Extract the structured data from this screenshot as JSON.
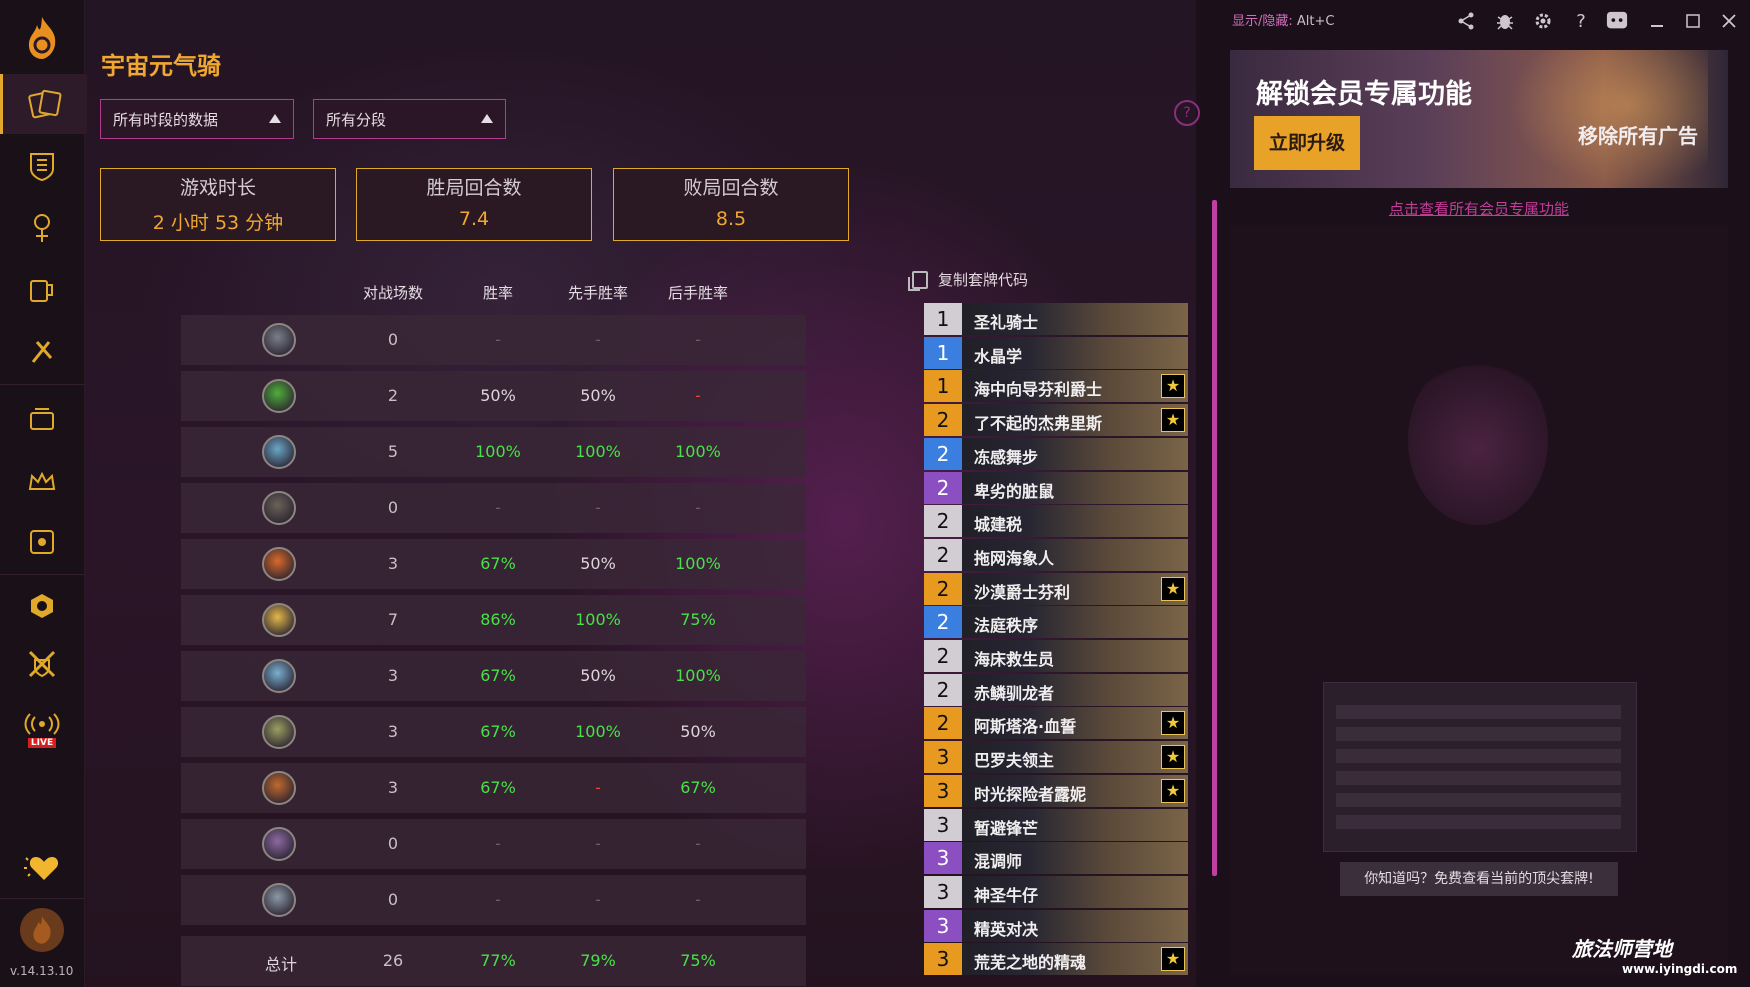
{
  "deck_title": "宇宙元气骑",
  "filters": {
    "time_range": "所有时段的数据",
    "rank_range": "所有分段"
  },
  "help_icon": "?",
  "stats": [
    {
      "label": "游戏时长",
      "value": "2 小时 53 分钟"
    },
    {
      "label": "胜局回合数",
      "value": "7.4"
    },
    {
      "label": "败局回合数",
      "value": "8.5"
    }
  ],
  "table": {
    "headers": [
      "对战场数",
      "胜率",
      "先手胜率",
      "后手胜率"
    ],
    "rows": [
      {
        "class_icon": "death-knight-icon",
        "games": "0",
        "winrate": "-",
        "first": "-",
        "second": "-",
        "colors": [
          "dim",
          "dim",
          "dim"
        ]
      },
      {
        "class_icon": "demon-hunter-icon",
        "games": "2",
        "winrate": "50%",
        "first": "50%",
        "second": "-",
        "colors": [
          "white",
          "white",
          "red"
        ]
      },
      {
        "class_icon": "druid-icon",
        "games": "5",
        "winrate": "100%",
        "first": "100%",
        "second": "100%",
        "colors": [
          "green",
          "green",
          "green"
        ]
      },
      {
        "class_icon": "hunter-icon",
        "games": "0",
        "winrate": "-",
        "first": "-",
        "second": "-",
        "colors": [
          "dim",
          "dim",
          "dim"
        ]
      },
      {
        "class_icon": "mage-icon",
        "games": "3",
        "winrate": "67%",
        "first": "50%",
        "second": "100%",
        "colors": [
          "green",
          "white",
          "green"
        ]
      },
      {
        "class_icon": "paladin-icon",
        "games": "7",
        "winrate": "86%",
        "first": "100%",
        "second": "75%",
        "colors": [
          "green",
          "green",
          "green"
        ]
      },
      {
        "class_icon": "priest-icon",
        "games": "3",
        "winrate": "67%",
        "first": "50%",
        "second": "100%",
        "colors": [
          "green",
          "white",
          "green"
        ]
      },
      {
        "class_icon": "rogue-icon",
        "games": "3",
        "winrate": "67%",
        "first": "100%",
        "second": "50%",
        "colors": [
          "green",
          "green",
          "white"
        ]
      },
      {
        "class_icon": "shaman-icon",
        "games": "3",
        "winrate": "67%",
        "first": "-",
        "second": "67%",
        "colors": [
          "green",
          "red",
          "green"
        ]
      },
      {
        "class_icon": "warlock-icon",
        "games": "0",
        "winrate": "-",
        "first": "-",
        "second": "-",
        "colors": [
          "dim",
          "dim",
          "dim"
        ]
      },
      {
        "class_icon": "warrior-icon",
        "games": "0",
        "winrate": "-",
        "first": "-",
        "second": "-",
        "colors": [
          "dim",
          "dim",
          "dim"
        ]
      }
    ],
    "total": {
      "label": "总计",
      "games": "26",
      "winrate": "77%",
      "first": "79%",
      "second": "75%"
    }
  },
  "deck": {
    "copy_label": "复制套牌代码",
    "cards": [
      {
        "cost": "1",
        "name": "圣礼骑士",
        "rarity": "common",
        "star": false
      },
      {
        "cost": "1",
        "name": "水晶学",
        "rarity": "rare",
        "star": false
      },
      {
        "cost": "1",
        "name": "海中向导芬利爵士",
        "rarity": "legend",
        "star": true
      },
      {
        "cost": "2",
        "name": "了不起的杰弗里斯",
        "rarity": "legend",
        "star": true
      },
      {
        "cost": "2",
        "name": "冻感舞步",
        "rarity": "rare",
        "star": false
      },
      {
        "cost": "2",
        "name": "卑劣的脏鼠",
        "rarity": "epic",
        "star": false
      },
      {
        "cost": "2",
        "name": "城建税",
        "rarity": "common",
        "star": false
      },
      {
        "cost": "2",
        "name": "拖网海象人",
        "rarity": "common",
        "star": false
      },
      {
        "cost": "2",
        "name": "沙漠爵士芬利",
        "rarity": "legend",
        "star": true
      },
      {
        "cost": "2",
        "name": "法庭秩序",
        "rarity": "rare",
        "star": false
      },
      {
        "cost": "2",
        "name": "海床救生员",
        "rarity": "common",
        "star": false
      },
      {
        "cost": "2",
        "name": "赤鳞驯龙者",
        "rarity": "common",
        "star": false
      },
      {
        "cost": "2",
        "name": "阿斯塔洛·血誓",
        "rarity": "legend",
        "star": true
      },
      {
        "cost": "3",
        "name": "巴罗夫领主",
        "rarity": "legend",
        "star": true
      },
      {
        "cost": "3",
        "name": "时光探险者露妮",
        "rarity": "legend",
        "star": true
      },
      {
        "cost": "3",
        "name": "暂避锋芒",
        "rarity": "common",
        "star": false
      },
      {
        "cost": "3",
        "name": "混调师",
        "rarity": "epic",
        "star": false
      },
      {
        "cost": "3",
        "name": "神圣牛仔",
        "rarity": "common",
        "star": false
      },
      {
        "cost": "3",
        "name": "精英对决",
        "rarity": "epic",
        "star": false
      },
      {
        "cost": "3",
        "name": "荒芜之地的精魂",
        "rarity": "legend",
        "star": true
      }
    ]
  },
  "topbar": {
    "hotkey_label": "显示/隐藏:",
    "hotkey": "Alt+C",
    "icons": [
      "share-icon",
      "bug-icon",
      "settings-icon",
      "help-icon",
      "discord-icon",
      "minimize-icon",
      "maximize-icon",
      "close-icon"
    ]
  },
  "banner": {
    "title": "解锁会员专属功能",
    "button": "立即升级",
    "remove_ads": "移除所有广告",
    "link": "点击查看所有会员专属功能"
  },
  "ad": {
    "tip": "你知道吗？免费查看当前的顶尖套牌!"
  },
  "watermark": {
    "brand": "旅法师营地",
    "url": "www.iyingdi.com"
  },
  "version": "v.14.13.10",
  "sidebar_icons": [
    "flame-logo-icon",
    "decks-icon",
    "battlegrounds-icon",
    "mercenaries-icon",
    "tavern-icon",
    "arena-icon",
    "packs-icon",
    "crown-icon",
    "treasure-icon",
    "collection-icon",
    "duels-icon",
    "live-icon",
    "favorite-icon",
    "profile-icon"
  ],
  "live_badge": "LIVE",
  "colors": {
    "accent": "#f0a830",
    "magenta": "#c03fa3",
    "green": "#47e247",
    "red": "#e8443a"
  }
}
